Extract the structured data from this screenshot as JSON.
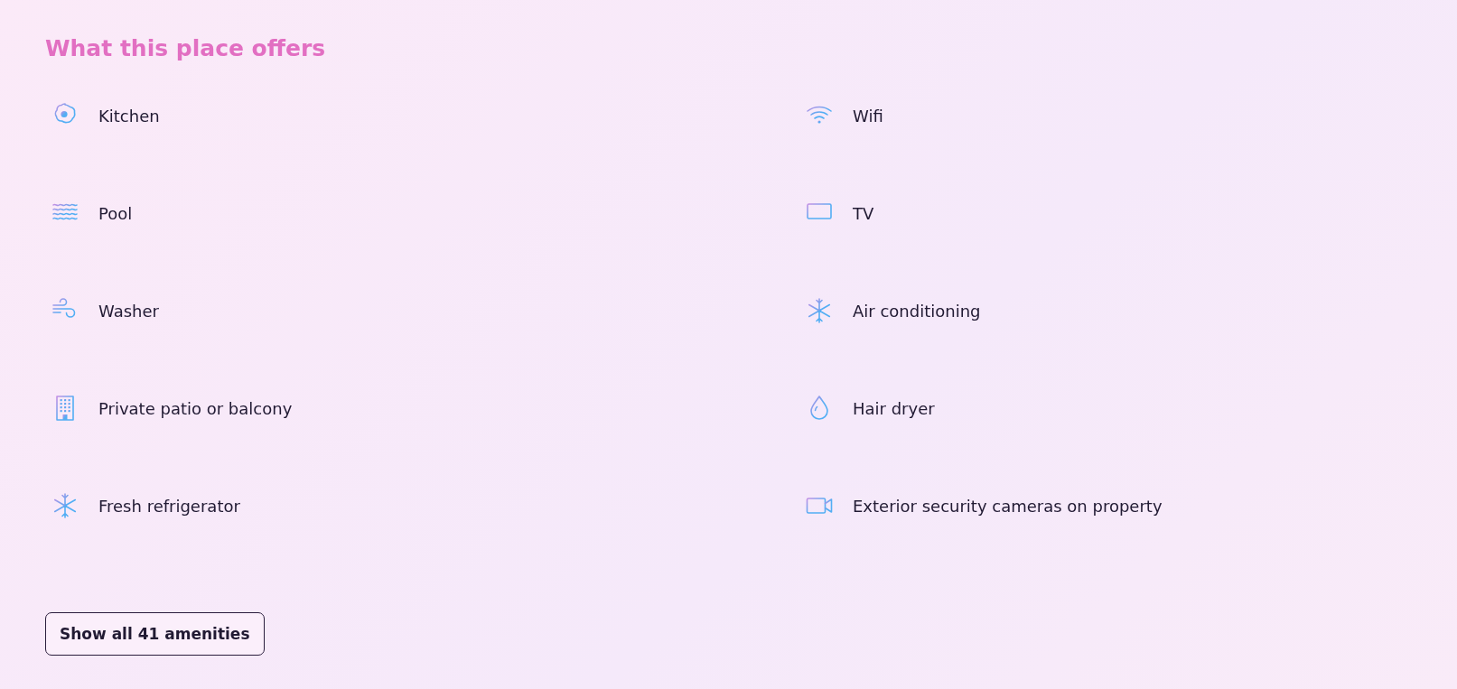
{
  "title": "What this place offers",
  "amenities": [
    {
      "label": "Kitchen"
    },
    {
      "label": "Wifi"
    },
    {
      "label": "Pool"
    },
    {
      "label": "TV"
    },
    {
      "label": "Washer"
    },
    {
      "label": "Air conditioning"
    },
    {
      "label": "Private patio or balcony"
    },
    {
      "label": "Hair dryer"
    },
    {
      "label": "Fresh refrigerator"
    },
    {
      "label": "Exterior security cameras on property"
    }
  ],
  "button": "Show all 41 amenities"
}
